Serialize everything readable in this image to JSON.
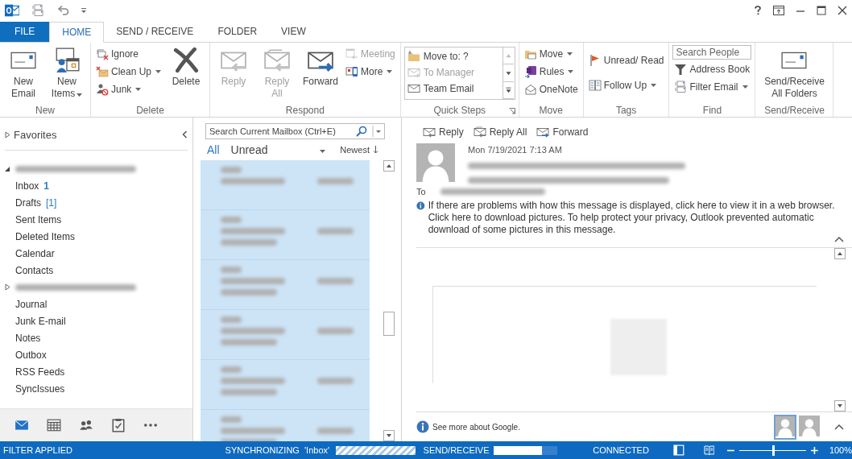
{
  "tabs": [
    {
      "label": "FILE",
      "kind": "file",
      "selected": false
    },
    {
      "label": "HOME",
      "kind": "tab",
      "selected": true
    },
    {
      "label": "SEND / RECEIVE",
      "kind": "tab",
      "selected": false
    },
    {
      "label": "FOLDER",
      "kind": "tab",
      "selected": false
    },
    {
      "label": "VIEW",
      "kind": "tab",
      "selected": false
    }
  ],
  "ribbon": {
    "groups": [
      {
        "label": "New",
        "columns": [
          [
            {
              "kind": "large",
              "label": "New Email",
              "disabled": false
            }
          ],
          [
            {
              "kind": "large",
              "label": "New Items",
              "dropdown": true,
              "disabled": false
            }
          ]
        ]
      },
      {
        "label": "Delete",
        "columns": [
          [
            {
              "kind": "small",
              "label": "Ignore",
              "disabled": false
            },
            {
              "kind": "small",
              "label": "Clean Up",
              "dropdown": true,
              "disabled": false
            },
            {
              "kind": "small",
              "label": "Junk",
              "dropdown": true,
              "disabled": false
            }
          ],
          [
            {
              "kind": "large",
              "label": "Delete",
              "disabled": false
            }
          ]
        ]
      },
      {
        "label": "Respond",
        "columns": [
          [
            {
              "kind": "large",
              "label": "Reply",
              "disabled": true
            }
          ],
          [
            {
              "kind": "large",
              "label": "Reply All",
              "disabled": true
            }
          ],
          [
            {
              "kind": "large",
              "label": "Forward",
              "disabled": false
            }
          ],
          [
            {
              "kind": "small",
              "label": "Meeting",
              "disabled": true
            },
            {
              "kind": "small",
              "label": "More",
              "dropdown": true,
              "disabled": false
            }
          ]
        ]
      },
      {
        "label": "Quick Steps",
        "launcher": true,
        "columns": [
          [
            {
              "kind": "gallery",
              "items": [
                {
                  "label": "Move to: ?",
                  "disabled": false
                },
                {
                  "label": "To Manager",
                  "disabled": true
                },
                {
                  "label": "Team Email",
                  "disabled": false
                }
              ]
            }
          ]
        ]
      },
      {
        "label": "Move",
        "columns": [
          [
            {
              "kind": "small",
              "label": "Move",
              "dropdown": true,
              "disabled": false
            },
            {
              "kind": "small",
              "label": "Rules",
              "dropdown": true,
              "disabled": false
            },
            {
              "kind": "small",
              "label": "OneNote",
              "disabled": false
            }
          ]
        ]
      },
      {
        "label": "Tags",
        "columns": [
          [
            {
              "kind": "small",
              "label": "Unread/ Read",
              "disabled": false
            },
            {
              "kind": "small",
              "label": "Follow Up",
              "dropdown": true,
              "disabled": false
            }
          ]
        ]
      },
      {
        "label": "Find",
        "columns": [
          [
            {
              "kind": "search",
              "placeholder": "Search People"
            },
            {
              "kind": "small",
              "label": "Address Book",
              "disabled": false
            },
            {
              "kind": "small",
              "label": "Filter Email",
              "dropdown": true,
              "disabled": false
            }
          ]
        ]
      },
      {
        "label": "Send/Receive",
        "columns": [
          [
            {
              "kind": "large",
              "label": "Send/Receive All Folders",
              "disabled": false
            }
          ]
        ]
      }
    ]
  },
  "nav": {
    "favorites": {
      "label": "Favorites",
      "expanded": false
    },
    "items": [
      {
        "kind": "account",
        "expanded": true
      },
      {
        "kind": "folder",
        "label": "Inbox",
        "count": "1"
      },
      {
        "kind": "folder",
        "label": "Drafts",
        "count": "[1]"
      },
      {
        "kind": "folder",
        "label": "Sent Items"
      },
      {
        "kind": "folder",
        "label": "Deleted Items"
      },
      {
        "kind": "folder",
        "label": "Calendar"
      },
      {
        "kind": "folder",
        "label": "Contacts"
      },
      {
        "kind": "account",
        "expanded": false
      },
      {
        "kind": "folder",
        "label": "Journal"
      },
      {
        "kind": "folder",
        "label": "Junk E-mail"
      },
      {
        "kind": "folder",
        "label": "Notes"
      },
      {
        "kind": "folder",
        "label": "Outbox"
      },
      {
        "kind": "folder",
        "label": "RSS Feeds"
      },
      {
        "kind": "folder",
        "label": "SyncIssues"
      }
    ],
    "bottom": [
      {
        "selected": true
      },
      {
        "selected": false
      },
      {
        "selected": false
      },
      {
        "selected": false
      },
      {
        "selected": false
      }
    ]
  },
  "list": {
    "search_placeholder": "Search Current Mailbox (Ctrl+E)",
    "filters": [
      {
        "label": "All",
        "selected": true
      },
      {
        "label": "Unread",
        "selected": false
      }
    ],
    "sort": "Newest",
    "messages": [
      {
        "selected": true
      },
      {
        "selected": true
      },
      {
        "selected": true
      },
      {
        "selected": true
      },
      {
        "selected": true
      },
      {
        "selected": true
      }
    ]
  },
  "reading": {
    "actions": [
      "Reply",
      "Reply All",
      "Forward"
    ],
    "date": "Mon 7/19/2021 7:13 AM",
    "to_label": "To",
    "info": [
      "If there are problems with how this message is displayed, click here to view it in a web browser.",
      "Click here to download pictures. To help protect your privacy, Outlook prevented automatic download of some pictures in this message."
    ],
    "people_note": "See more about Google.",
    "people": [
      {
        "selected": true
      },
      {
        "selected": false
      }
    ]
  },
  "status_bar": {
    "filter": "FILTER APPLIED",
    "sync": "SYNCHRONIZING  'Inbox'",
    "sync_progress": {
      "level": 1
    },
    "send_receive": "SEND/RECEIVE",
    "send_receive_progress": {
      "level": 0.76
    },
    "connection": "CONNECTED",
    "zoom": {
      "level": 0.5
    },
    "zoom_text": "100%"
  }
}
